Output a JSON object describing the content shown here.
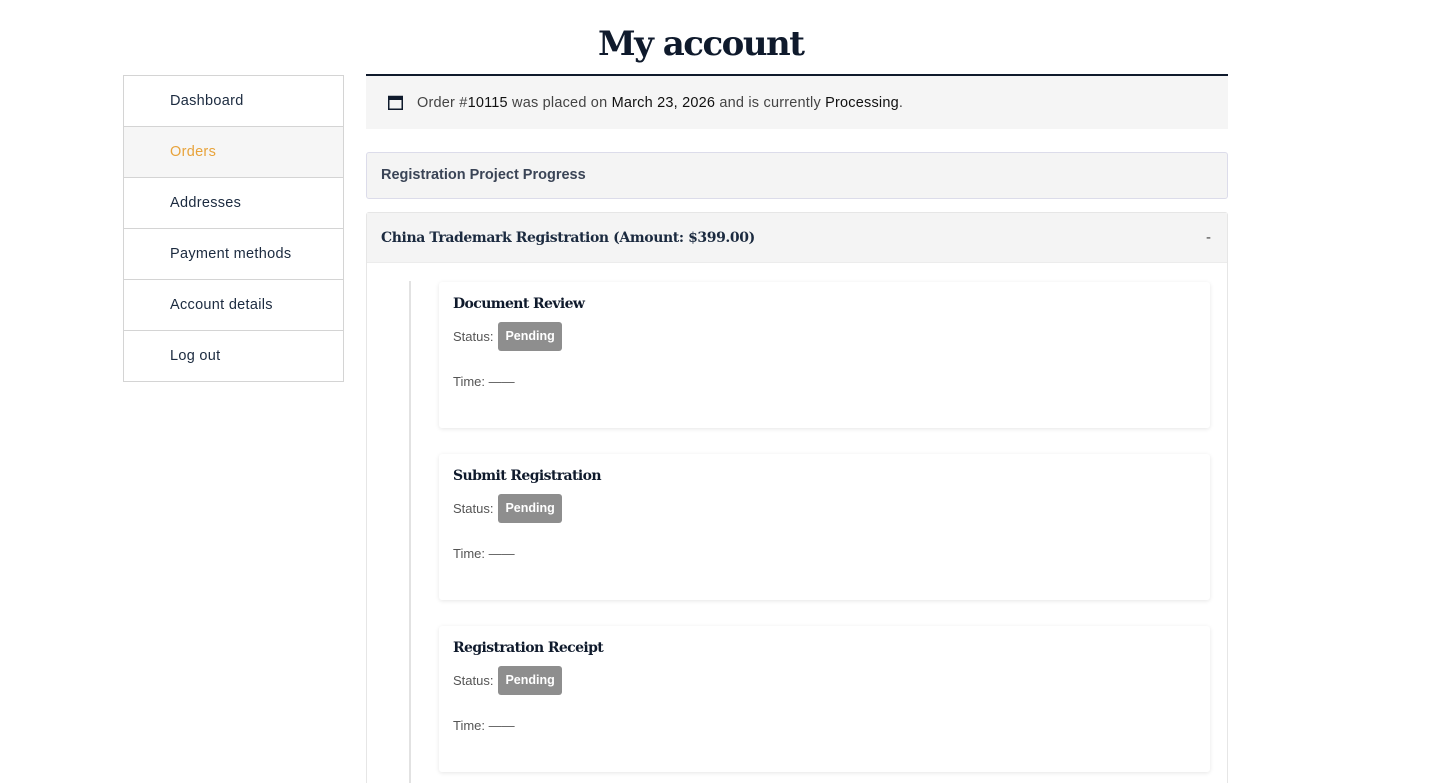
{
  "page": {
    "title": "My account"
  },
  "sidebar": {
    "items": [
      {
        "label": "Dashboard"
      },
      {
        "label": "Orders"
      },
      {
        "label": "Addresses"
      },
      {
        "label": "Payment methods"
      },
      {
        "label": "Account details"
      },
      {
        "label": "Log out"
      }
    ],
    "active_color": "#e8a33b"
  },
  "order_notice": {
    "prefix": "Order #",
    "order_number": "10115",
    "middle": " was placed on ",
    "date": "March 23, 2026",
    "suffix": " and is currently ",
    "status": "Processing",
    "end": ".",
    "icon": "calendar-icon"
  },
  "progress": {
    "header": "Registration Project Progress"
  },
  "service": {
    "title": "China Trademark Registration (Amount: $399.00)",
    "toggle": "-",
    "steps": [
      {
        "title": "Document Review",
        "status_label": "Status:",
        "status": "Pending",
        "time": "Time: ——"
      },
      {
        "title": "Submit Registration",
        "status_label": "Status:",
        "status": "Pending",
        "time": "Time: ——"
      },
      {
        "title": "Registration Receipt",
        "status_label": "Status:",
        "status": "Pending",
        "time": "Time: ——"
      }
    ]
  }
}
